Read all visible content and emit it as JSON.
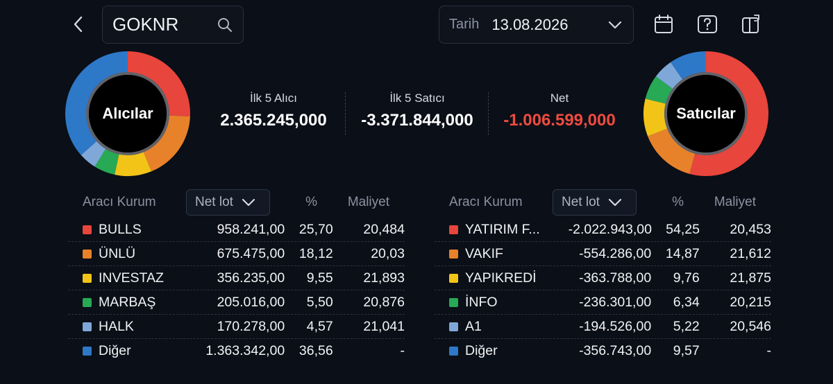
{
  "header": {
    "search_value": "GOKNR",
    "date_label": "Tarih",
    "date_value": "13.08.2026"
  },
  "colors": {
    "red": "#e8453c",
    "orange": "#e8822a",
    "yellow": "#f2c418",
    "green": "#27a955",
    "lightblue": "#7fa8d8",
    "blue": "#2e78c8",
    "negative": "#ef4b3f"
  },
  "left_donut": {
    "label": "Alıcılar",
    "segments": [
      {
        "value": 25.7,
        "color": "#e8453c"
      },
      {
        "value": 18.12,
        "color": "#e8822a"
      },
      {
        "value": 9.55,
        "color": "#f2c418"
      },
      {
        "value": 5.5,
        "color": "#27a955"
      },
      {
        "value": 4.57,
        "color": "#7fa8d8"
      },
      {
        "value": 36.56,
        "color": "#2e78c8"
      }
    ]
  },
  "right_donut": {
    "label": "Satıcılar",
    "segments": [
      {
        "value": 54.25,
        "color": "#e8453c"
      },
      {
        "value": 14.87,
        "color": "#e8822a"
      },
      {
        "value": 9.76,
        "color": "#f2c418"
      },
      {
        "value": 6.34,
        "color": "#27a955"
      },
      {
        "value": 5.22,
        "color": "#7fa8d8"
      },
      {
        "value": 9.57,
        "color": "#2e78c8"
      }
    ]
  },
  "summary": {
    "buyers_label": "İlk 5 Alıcı",
    "buyers_value": "2.365.245,000",
    "sellers_label": "İlk 5 Satıcı",
    "sellers_value": "-3.371.844,000",
    "net_label": "Net",
    "net_value": "-1.006.599,000"
  },
  "table_headers": {
    "broker": "Aracı Kurum",
    "net_lot": "Net lot",
    "percent": "%",
    "cost": "Maliyet"
  },
  "buyers": [
    {
      "name": "BULLS",
      "lot": "958.241,00",
      "pct": "25,70",
      "cost": "20,484",
      "color": "#e8453c"
    },
    {
      "name": "ÜNLÜ",
      "lot": "675.475,00",
      "pct": "18,12",
      "cost": "20,03",
      "color": "#e8822a"
    },
    {
      "name": "INVESTAZ",
      "lot": "356.235,00",
      "pct": "9,55",
      "cost": "21,893",
      "color": "#f2c418"
    },
    {
      "name": "MARBAŞ",
      "lot": "205.016,00",
      "pct": "5,50",
      "cost": "20,876",
      "color": "#27a955"
    },
    {
      "name": "HALK",
      "lot": "170.278,00",
      "pct": "4,57",
      "cost": "21,041",
      "color": "#7fa8d8"
    },
    {
      "name": "Diğer",
      "lot": "1.363.342,00",
      "pct": "36,56",
      "cost": "-",
      "color": "#2e78c8"
    }
  ],
  "sellers": [
    {
      "name": "YATIRIM F...",
      "lot": "-2.022.943,00",
      "pct": "54,25",
      "cost": "20,453",
      "color": "#e8453c"
    },
    {
      "name": "VAKIF",
      "lot": "-554.286,00",
      "pct": "14,87",
      "cost": "21,612",
      "color": "#e8822a"
    },
    {
      "name": "YAPIKREDİ",
      "lot": "-363.788,00",
      "pct": "9,76",
      "cost": "21,875",
      "color": "#f2c418"
    },
    {
      "name": "İNFO",
      "lot": "-236.301,00",
      "pct": "6,34",
      "cost": "20,215",
      "color": "#27a955"
    },
    {
      "name": "A1",
      "lot": "-194.526,00",
      "pct": "5,22",
      "cost": "20,546",
      "color": "#7fa8d8"
    },
    {
      "name": "Diğer",
      "lot": "-356.743,00",
      "pct": "9,57",
      "cost": "-",
      "color": "#2e78c8"
    }
  ]
}
